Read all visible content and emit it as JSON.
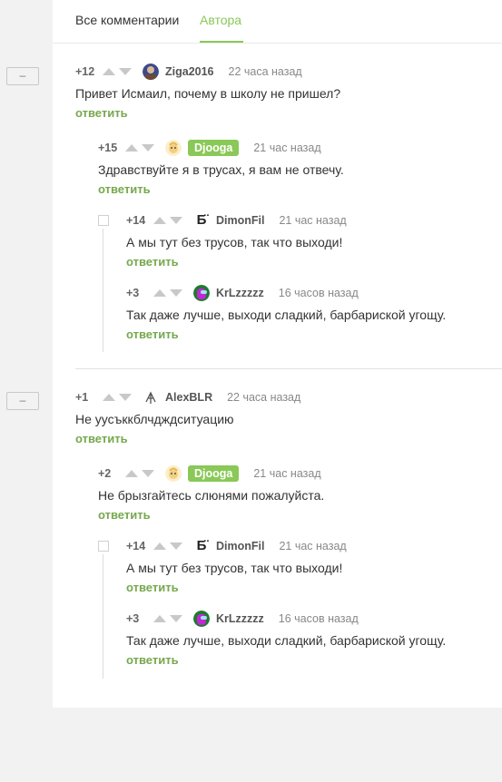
{
  "tabs": {
    "all": "Все комментарии",
    "author": "Автора"
  },
  "collapse_label": "–",
  "reply_label": "ответить",
  "colors": {
    "accent": "#8ac858",
    "reply": "#76a84d"
  },
  "threads": [
    {
      "root": {
        "rating": "+12",
        "nick": "Ziga2016",
        "time": "22 часа назад",
        "text": "Привет Исмаил, почему в школу не пришел?",
        "avatar": "photo-avatar"
      },
      "reply1": {
        "rating": "+15",
        "nick": "Djooga",
        "time": "21 час назад",
        "text": "Здравствуйте я в трусах, я вам не отвечу.",
        "avatar": "cartoon-avatar"
      },
      "reply2": {
        "rating": "+14",
        "nick": "DimonFil",
        "time": "21 час назад",
        "text": "А мы тут без трусов, так что выходи!",
        "avatar": "letter-avatar",
        "avatar_letter": "Б̈"
      },
      "reply3": {
        "rating": "+3",
        "nick": "KrLzzzzz",
        "time": "16 часов назад",
        "text": "Так даже лучше, выходи сладкий, барбариской угощу.",
        "avatar": "amongus-avatar"
      }
    },
    {
      "root": {
        "rating": "+1",
        "nick": "AlexBLR",
        "time": "22 часа назад",
        "text": "Не уусъккблчдждситуацию",
        "avatar": "sketch-avatar"
      },
      "reply1": {
        "rating": "+2",
        "nick": "Djooga",
        "time": "21 час назад",
        "text": "Не брызгайтесь слюнями пожалуйста.",
        "avatar": "cartoon-avatar"
      },
      "reply2": {
        "rating": "+14",
        "nick": "DimonFil",
        "time": "21 час назад",
        "text": "А мы тут без трусов, так что выходи!",
        "avatar": "letter-avatar",
        "avatar_letter": "Б̈"
      },
      "reply3": {
        "rating": "+3",
        "nick": "KrLzzzzz",
        "time": "16 часов назад",
        "text": "Так даже лучше, выходи сладкий, барбариской угощу.",
        "avatar": "amongus-avatar"
      }
    }
  ]
}
